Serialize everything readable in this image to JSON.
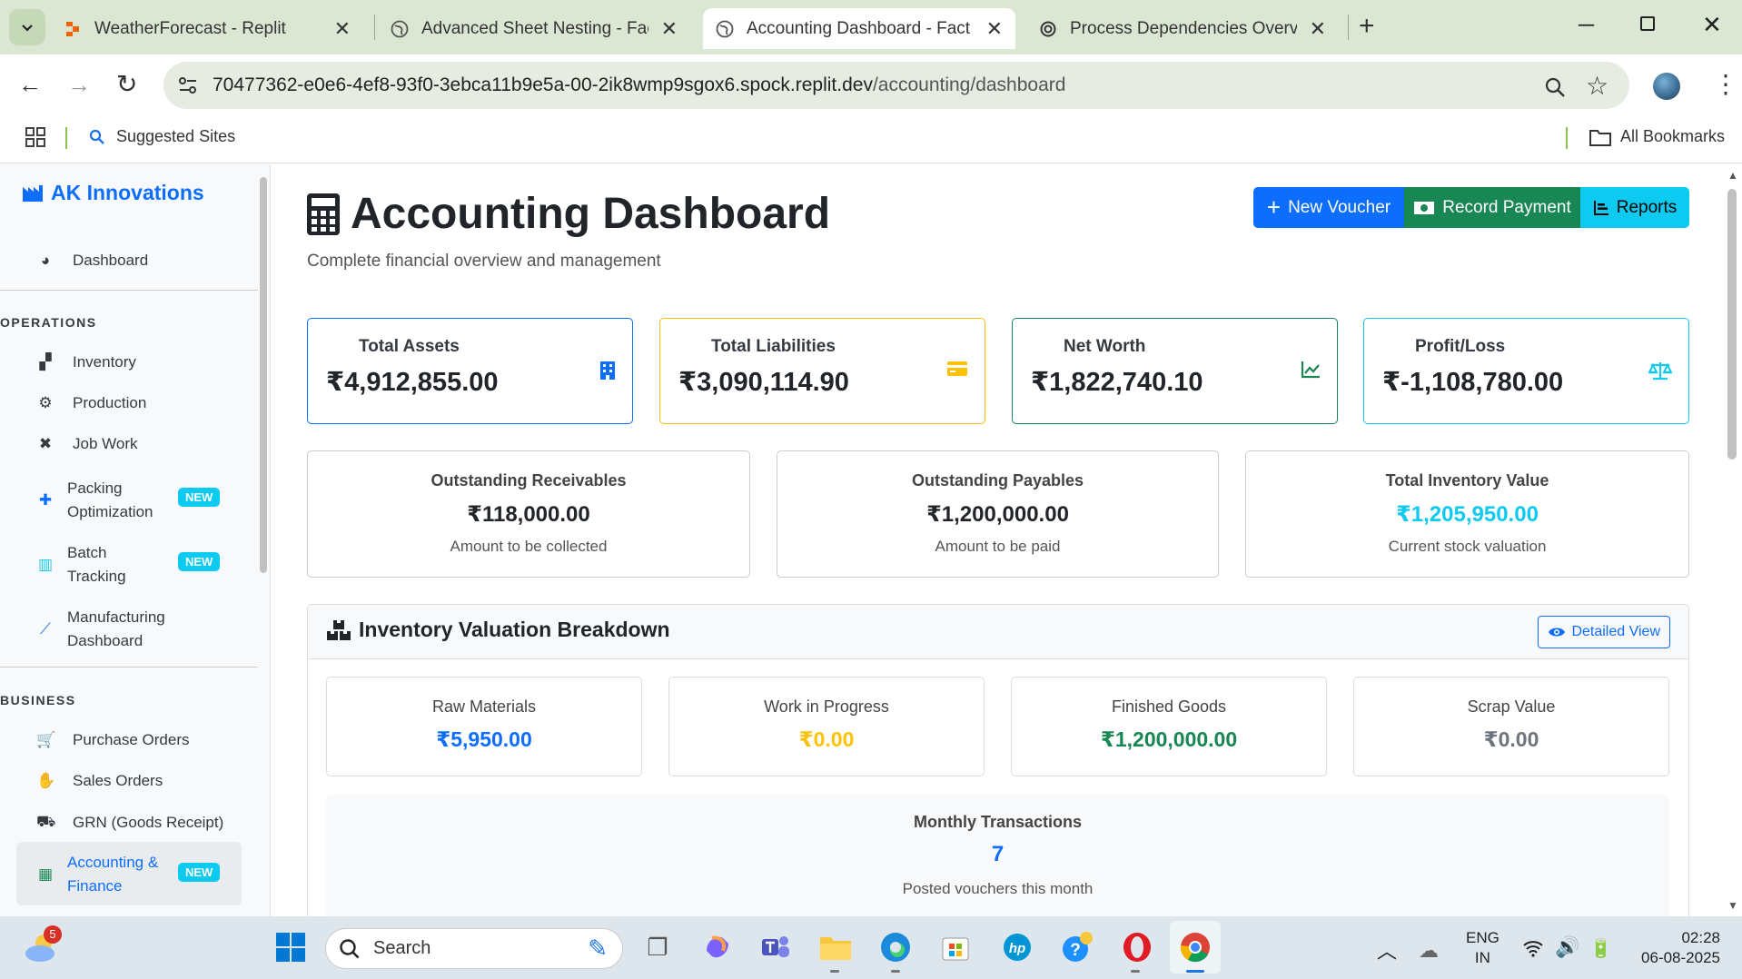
{
  "browser": {
    "tabs": [
      {
        "title": "WeatherForecast - Replit",
        "icon": "replit-icon",
        "color": "#f26207"
      },
      {
        "title": "Advanced Sheet Nesting - Factory",
        "icon": "globe-icon",
        "color": "#555555"
      },
      {
        "title": "Accounting Dashboard - Factory",
        "icon": "globe-icon",
        "color": "#555555",
        "active": true
      },
      {
        "title": "Process Dependencies Overview",
        "icon": "openai-icon",
        "color": "#333333"
      }
    ],
    "url_host": "70477362-e0e6-4ef8-93f0-3ebca11b9e5a-00-2ik8wmp9sgox6.spock.replit.dev",
    "url_path": "/accounting/dashboard",
    "bookmarks": {
      "suggested": "Suggested Sites",
      "all": "All Bookmarks"
    }
  },
  "sidebar": {
    "brand": "AK Innovations",
    "dashboard": "Dashboard",
    "sections": {
      "operations": "OPERATIONS",
      "business": "BUSINESS"
    },
    "operations": [
      {
        "label": "Inventory",
        "icon": "boxes-icon"
      },
      {
        "label": "Production",
        "icon": "cogs-icon"
      },
      {
        "label": "Job Work",
        "icon": "tools-icon"
      },
      {
        "label": "Packing Optimization",
        "line1": "Packing",
        "line2": "Optimization",
        "icon": "puzzle-icon",
        "badge": "NEW"
      },
      {
        "label": "Batch Tracking",
        "line1": "Batch",
        "line2": "Tracking",
        "icon": "barcode-icon",
        "badge": "NEW"
      },
      {
        "label": "Manufacturing Dashboard",
        "line1": "Manufacturing",
        "line2": "Dashboard",
        "icon": "chart-line-icon"
      }
    ],
    "business": [
      {
        "label": "Purchase Orders",
        "icon": "cart-icon"
      },
      {
        "label": "Sales Orders",
        "icon": "handshake-icon"
      },
      {
        "label": "GRN (Goods Receipt)",
        "icon": "truck-icon"
      },
      {
        "label": "Accounting & Finance",
        "line1": "Accounting &",
        "line2": "Finance",
        "icon": "calculator-icon",
        "badge": "NEW",
        "active": true
      }
    ]
  },
  "header": {
    "title": "Accounting Dashboard",
    "subtitle": "Complete financial overview and management",
    "buttons": {
      "new_voucher": "New Voucher",
      "record_payment": "Record Payment",
      "reports": "Reports"
    }
  },
  "stats": [
    {
      "label": "Total Assets",
      "value": "₹4,912,855.00",
      "color": "#0d6efd",
      "icon": "building-icon"
    },
    {
      "label": "Total Liabilities",
      "value": "₹3,090,114.90",
      "color": "#ffc107",
      "icon": "credit-card-icon"
    },
    {
      "label": "Net Worth",
      "value": "₹1,822,740.10",
      "color": "#198754",
      "icon": "chart-line-icon"
    },
    {
      "label": "Profit/Loss",
      "value": "₹-1,108,780.00",
      "color": "#0dcaf0",
      "icon": "balance-scale-icon"
    }
  ],
  "outstanding": [
    {
      "title": "Outstanding Receivables",
      "value": "₹118,000.00",
      "sub": "Amount to be collected",
      "color": "#212529"
    },
    {
      "title": "Outstanding Payables",
      "value": "₹1,200,000.00",
      "sub": "Amount to be paid",
      "color": "#212529"
    },
    {
      "title": "Total Inventory Value",
      "value": "₹1,205,950.00",
      "sub": "Current stock valuation",
      "color": "#0dcaf0"
    }
  ],
  "inventory": {
    "title": "Inventory Valuation Breakdown",
    "detailed_view": "Detailed View",
    "items": [
      {
        "label": "Raw Materials",
        "value": "₹5,950.00",
        "color": "#0d6efd"
      },
      {
        "label": "Work in Progress",
        "value": "₹0.00",
        "color": "#ffc107"
      },
      {
        "label": "Finished Goods",
        "value": "₹1,200,000.00",
        "color": "#198754"
      },
      {
        "label": "Scrap Value",
        "value": "₹0.00",
        "color": "#6c757d"
      }
    ],
    "monthly": {
      "title": "Monthly Transactions",
      "value": "7",
      "sub": "Posted vouchers this month"
    }
  },
  "taskbar": {
    "search": "Search",
    "weather_badge": "5",
    "lang1": "ENG",
    "lang2": "IN",
    "time": "02:28",
    "date": "06-08-2025"
  }
}
